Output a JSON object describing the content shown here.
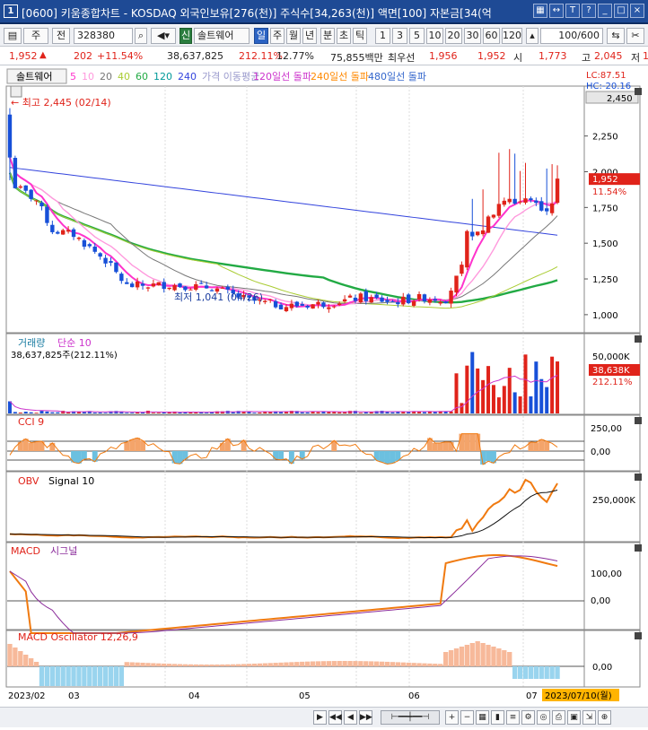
{
  "window": {
    "num": "1",
    "title": "[0600] 키움종합차트 - KOSDAQ 외국인보유[276(천)] 주식수[34,263(천)] 액면[100] 자본금[34(억"
  },
  "toolbar": {
    "type": "주",
    "prev": "전",
    "code": "328380",
    "name": "솔트웨어",
    "tag_new": "신",
    "periods": [
      "일",
      "주",
      "월",
      "년",
      "분",
      "초",
      "틱"
    ],
    "nums": [
      "1",
      "3",
      "5",
      "10",
      "20",
      "30",
      "60",
      "120"
    ],
    "count": "100/600"
  },
  "quote": {
    "price": "1,952",
    "arrow": "▲",
    "change": "202",
    "pct": "+11.54%",
    "volume": "38,637,825",
    "vol_ratio": "212.11%",
    "turnover": "12.77%",
    "amount": "75,855백만",
    "best_label": "최우선",
    "best_ask": "1,956",
    "best_bid": "1,952",
    "open_label": "시",
    "open": "1,773",
    "high_label": "고",
    "high": "2,045",
    "low_label": "저",
    "low": "1"
  },
  "legend": {
    "name": "솔트웨어",
    "ma": [
      {
        "label": "5",
        "color": "#ff33cc"
      },
      {
        "label": "10",
        "color": "#ff99dd"
      },
      {
        "label": "20",
        "color": "#777777"
      },
      {
        "label": "40",
        "color": "#aacc33"
      },
      {
        "label": "60",
        "color": "#22aa44"
      },
      {
        "label": "120",
        "color": "#009999"
      },
      {
        "label": "240",
        "color": "#3344dd"
      },
      {
        "label": "가격 이동평균",
        "color": "#9999cc"
      },
      {
        "label": "120일선 돌파",
        "color": "#cc33cc"
      },
      {
        "label": "240일선 돌파",
        "color": "#ff8800"
      },
      {
        "label": "480일선 돌파",
        "color": "#3366cc"
      }
    ]
  },
  "price_axis": {
    "hilo": "LC:87.51",
    "hc": "HC:-20.16",
    "top": "2,450",
    "ticks": [
      "2,250",
      "2,000",
      "1,750",
      "1,500",
      "1,250",
      "1,000"
    ],
    "cur": "1,952",
    "cur_pct": "11.54%"
  },
  "annot": {
    "high": "최고 2,445 (02/14)",
    "low": "최저 1,041 (04/26)"
  },
  "vol_panel": {
    "title": "거래량",
    "sub": "단순 10",
    "value": "38,637,825주(212.11%)",
    "tick": "50,000K",
    "cur": "38,638K",
    "cur_pct": "212.11%"
  },
  "cci_panel": {
    "title": "CCI 9",
    "ticks": [
      "250,00",
      "0,00"
    ]
  },
  "obv_panel": {
    "title": "OBV",
    "sub": "Signal 10",
    "tick": "250,000K"
  },
  "macd_panel": {
    "title": "MACD",
    "sub": "시그널",
    "ticks": [
      "100,00",
      "0,00"
    ]
  },
  "osc_panel": {
    "title": "MACD Oscillator 12,26,9",
    "tick": "0,00"
  },
  "xaxis": {
    "labels": [
      "2023/02",
      "03",
      "04",
      "05",
      "06",
      "07"
    ],
    "date": "2023/07/10(월)"
  },
  "colors": {
    "up": "#e0231a",
    "down": "#1750d8",
    "orange": "#f07a10"
  }
}
